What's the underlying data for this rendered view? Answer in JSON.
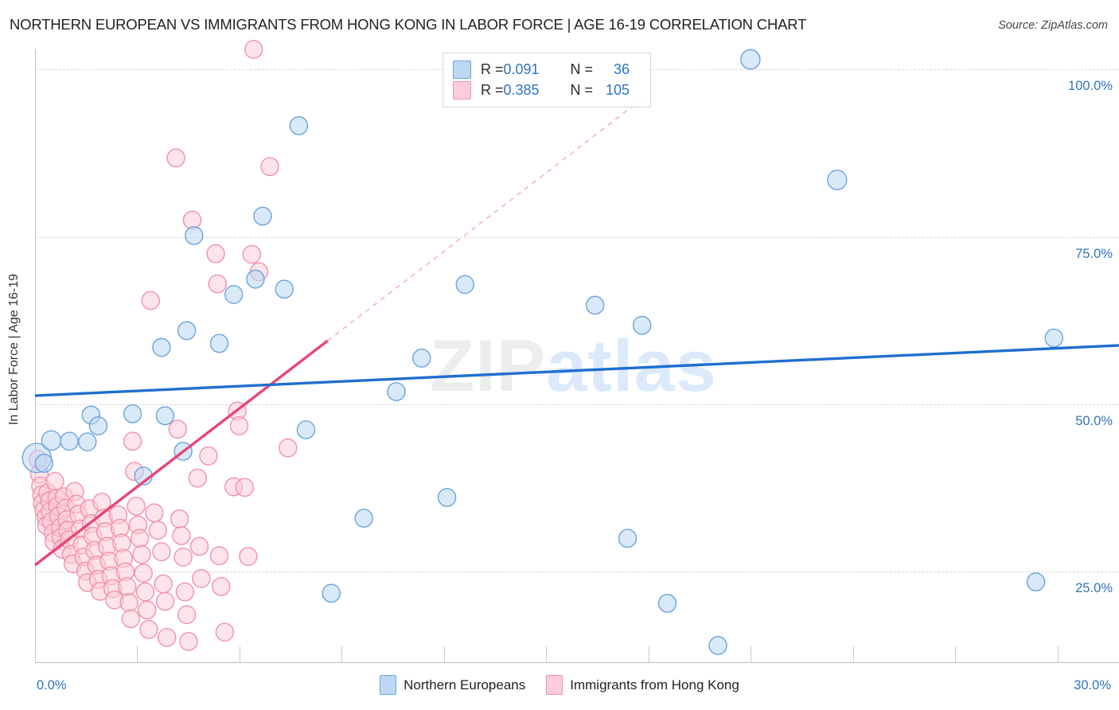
{
  "header": {
    "title": "NORTHERN EUROPEAN VS IMMIGRANTS FROM HONG KONG IN LABOR FORCE | AGE 16-19 CORRELATION CHART",
    "source": "Source: ZipAtlas.com"
  },
  "watermark": {
    "part1": "ZIP",
    "part2": "atlas"
  },
  "stat_legend": {
    "rows": [
      {
        "series": "Northern Europeans",
        "r_label": "R =",
        "r_value": "0.091",
        "n_label": "N =",
        "n_value": "36",
        "color": "#bcd7f2"
      },
      {
        "series": "Immigrants from Hong Kong",
        "r_label": "R =",
        "r_value": "0.385",
        "n_label": "N =",
        "n_value": "105",
        "color": "#fbccd9"
      }
    ]
  },
  "series_legend": {
    "items": [
      {
        "label": "Northern Europeans",
        "color": "#bcd7f2",
        "border": "#6ba3dd"
      },
      {
        "label": "Immigrants from Hong Kong",
        "color": "#fbccd9",
        "border": "#f092ac"
      }
    ]
  },
  "chart_data": {
    "type": "scatter",
    "title": "NORTHERN EUROPEAN VS IMMIGRANTS FROM HONG KONG IN LABOR FORCE | AGE 16-19 CORRELATION CHART",
    "xlabel": "",
    "ylabel": "In Labor Force | Age 16-19",
    "xlim": [
      0.0,
      30.0
    ],
    "ylim": [
      11.5,
      103.0
    ],
    "x_tick_labels": [
      "0.0%",
      "30.0%"
    ],
    "y_tick_labels": [
      "100.0%",
      "75.0%",
      "50.0%",
      "25.0%"
    ],
    "y_ticks": [
      100.0,
      75.0,
      50.0,
      25.0
    ],
    "grid": true,
    "legend_position": "bottom-center",
    "series": [
      {
        "name": "Northern Europeans",
        "color": "#bcd7f2",
        "border": "#6ba3dd",
        "r": 0.091,
        "n": 36,
        "trend": {
          "x0": 0.0,
          "y0": 51.3,
          "x1": 30.0,
          "y1": 58.8,
          "style": "solid",
          "color": "#1f6fd0"
        },
        "points": [
          {
            "x": 0.05,
            "y": 42.0,
            "r": 18
          },
          {
            "x": 0.45,
            "y": 44.6,
            "r": 12
          },
          {
            "x": 0.95,
            "y": 44.5,
            "r": 11
          },
          {
            "x": 1.45,
            "y": 44.4,
            "r": 11
          },
          {
            "x": 1.55,
            "y": 48.4,
            "r": 11
          },
          {
            "x": 1.75,
            "y": 46.8,
            "r": 11
          },
          {
            "x": 2.7,
            "y": 48.6,
            "r": 11
          },
          {
            "x": 3.0,
            "y": 39.3,
            "r": 11
          },
          {
            "x": 3.5,
            "y": 58.5,
            "r": 11
          },
          {
            "x": 3.6,
            "y": 48.3,
            "r": 11
          },
          {
            "x": 4.1,
            "y": 43.0,
            "r": 11
          },
          {
            "x": 4.2,
            "y": 61.0,
            "r": 11
          },
          {
            "x": 4.4,
            "y": 75.2,
            "r": 11
          },
          {
            "x": 5.1,
            "y": 59.1,
            "r": 11
          },
          {
            "x": 5.5,
            "y": 66.4,
            "r": 11
          },
          {
            "x": 6.1,
            "y": 68.7,
            "r": 11
          },
          {
            "x": 6.3,
            "y": 78.1,
            "r": 11
          },
          {
            "x": 6.9,
            "y": 67.2,
            "r": 11
          },
          {
            "x": 7.3,
            "y": 91.6,
            "r": 11
          },
          {
            "x": 7.5,
            "y": 46.2,
            "r": 11
          },
          {
            "x": 8.2,
            "y": 21.8,
            "r": 11
          },
          {
            "x": 9.1,
            "y": 33.0,
            "r": 11
          },
          {
            "x": 10.0,
            "y": 51.9,
            "r": 11
          },
          {
            "x": 10.7,
            "y": 56.9,
            "r": 11
          },
          {
            "x": 11.4,
            "y": 36.1,
            "r": 11
          },
          {
            "x": 11.9,
            "y": 67.9,
            "r": 11
          },
          {
            "x": 15.5,
            "y": 64.8,
            "r": 11
          },
          {
            "x": 16.4,
            "y": 30.0,
            "r": 11
          },
          {
            "x": 16.8,
            "y": 61.8,
            "r": 11
          },
          {
            "x": 17.5,
            "y": 20.3,
            "r": 11
          },
          {
            "x": 18.9,
            "y": 14.0,
            "r": 11
          },
          {
            "x": 19.8,
            "y": 101.5,
            "r": 12
          },
          {
            "x": 22.2,
            "y": 83.5,
            "r": 12
          },
          {
            "x": 27.7,
            "y": 23.5,
            "r": 11
          },
          {
            "x": 28.2,
            "y": 59.9,
            "r": 11
          },
          {
            "x": 0.25,
            "y": 41.2,
            "r": 11
          }
        ]
      },
      {
        "name": "Immigrants from Hong Kong",
        "color": "#fbccd9",
        "border": "#f092ac",
        "r": 0.385,
        "n": 105,
        "trend": {
          "x0": 0.0,
          "y0": 26.0,
          "x1": 8.1,
          "y1": 59.5,
          "style": "solid",
          "color": "#e8447a",
          "dash_x0": 8.1,
          "dash_y0": 59.5,
          "dash_x1": 16.9,
          "dash_y1": 96.0,
          "dash_color": "#f0a8bd"
        },
        "points": [
          {
            "x": 0.08,
            "y": 41.8,
            "r": 11
          },
          {
            "x": 0.12,
            "y": 39.6,
            "r": 11
          },
          {
            "x": 0.15,
            "y": 37.8,
            "r": 11
          },
          {
            "x": 0.18,
            "y": 36.5,
            "r": 11
          },
          {
            "x": 0.2,
            "y": 35.2,
            "r": 11
          },
          {
            "x": 0.25,
            "y": 34.2,
            "r": 11
          },
          {
            "x": 0.3,
            "y": 33.1,
            "r": 11
          },
          {
            "x": 0.32,
            "y": 31.9,
            "r": 11
          },
          {
            "x": 0.35,
            "y": 36.8,
            "r": 11
          },
          {
            "x": 0.4,
            "y": 35.6,
            "r": 11
          },
          {
            "x": 0.42,
            "y": 34.0,
            "r": 11
          },
          {
            "x": 0.45,
            "y": 32.5,
            "r": 11
          },
          {
            "x": 0.5,
            "y": 30.8,
            "r": 11
          },
          {
            "x": 0.52,
            "y": 29.5,
            "r": 11
          },
          {
            "x": 0.55,
            "y": 38.5,
            "r": 11
          },
          {
            "x": 0.6,
            "y": 36.0,
            "r": 11
          },
          {
            "x": 0.62,
            "y": 34.8,
            "r": 11
          },
          {
            "x": 0.65,
            "y": 33.3,
            "r": 11
          },
          {
            "x": 0.7,
            "y": 31.6,
            "r": 11
          },
          {
            "x": 0.72,
            "y": 30.1,
            "r": 11
          },
          {
            "x": 0.75,
            "y": 28.4,
            "r": 11
          },
          {
            "x": 0.8,
            "y": 36.2,
            "r": 11
          },
          {
            "x": 0.85,
            "y": 34.5,
            "r": 11
          },
          {
            "x": 0.88,
            "y": 32.8,
            "r": 11
          },
          {
            "x": 0.9,
            "y": 31.2,
            "r": 11
          },
          {
            "x": 0.95,
            "y": 29.8,
            "r": 11
          },
          {
            "x": 1.0,
            "y": 27.6,
            "r": 11
          },
          {
            "x": 1.05,
            "y": 26.2,
            "r": 11
          },
          {
            "x": 1.1,
            "y": 37.0,
            "r": 11
          },
          {
            "x": 1.15,
            "y": 35.1,
            "r": 11
          },
          {
            "x": 1.2,
            "y": 33.6,
            "r": 11
          },
          {
            "x": 1.25,
            "y": 31.4,
            "r": 11
          },
          {
            "x": 1.3,
            "y": 29.0,
            "r": 11
          },
          {
            "x": 1.35,
            "y": 27.2,
            "r": 11
          },
          {
            "x": 1.4,
            "y": 25.1,
            "r": 11
          },
          {
            "x": 1.45,
            "y": 23.4,
            "r": 11
          },
          {
            "x": 1.5,
            "y": 34.4,
            "r": 11
          },
          {
            "x": 1.55,
            "y": 32.2,
            "r": 11
          },
          {
            "x": 1.6,
            "y": 30.3,
            "r": 11
          },
          {
            "x": 1.65,
            "y": 28.2,
            "r": 11
          },
          {
            "x": 1.7,
            "y": 26.0,
            "r": 11
          },
          {
            "x": 1.75,
            "y": 23.9,
            "r": 11
          },
          {
            "x": 1.8,
            "y": 22.1,
            "r": 11
          },
          {
            "x": 1.85,
            "y": 35.4,
            "r": 11
          },
          {
            "x": 1.9,
            "y": 33.0,
            "r": 11
          },
          {
            "x": 1.95,
            "y": 31.0,
            "r": 11
          },
          {
            "x": 2.0,
            "y": 28.8,
            "r": 11
          },
          {
            "x": 2.05,
            "y": 26.6,
            "r": 11
          },
          {
            "x": 2.1,
            "y": 24.4,
            "r": 11
          },
          {
            "x": 2.15,
            "y": 22.5,
            "r": 11
          },
          {
            "x": 2.2,
            "y": 20.8,
            "r": 11
          },
          {
            "x": 2.3,
            "y": 33.5,
            "r": 11
          },
          {
            "x": 2.35,
            "y": 31.5,
            "r": 11
          },
          {
            "x": 2.4,
            "y": 29.3,
            "r": 11
          },
          {
            "x": 2.45,
            "y": 27.0,
            "r": 11
          },
          {
            "x": 2.5,
            "y": 25.0,
            "r": 11
          },
          {
            "x": 2.55,
            "y": 22.8,
            "r": 11
          },
          {
            "x": 2.6,
            "y": 20.4,
            "r": 11
          },
          {
            "x": 2.65,
            "y": 18.0,
            "r": 11
          },
          {
            "x": 2.7,
            "y": 44.5,
            "r": 11
          },
          {
            "x": 2.75,
            "y": 40.0,
            "r": 11
          },
          {
            "x": 2.8,
            "y": 34.8,
            "r": 11
          },
          {
            "x": 2.85,
            "y": 32.0,
            "r": 11
          },
          {
            "x": 2.9,
            "y": 30.0,
            "r": 11
          },
          {
            "x": 2.95,
            "y": 27.6,
            "r": 11
          },
          {
            "x": 3.0,
            "y": 24.8,
            "r": 11
          },
          {
            "x": 3.05,
            "y": 22.0,
            "r": 11
          },
          {
            "x": 3.1,
            "y": 19.3,
            "r": 11
          },
          {
            "x": 3.15,
            "y": 16.4,
            "r": 11
          },
          {
            "x": 3.2,
            "y": 65.5,
            "r": 11
          },
          {
            "x": 3.3,
            "y": 33.8,
            "r": 11
          },
          {
            "x": 3.4,
            "y": 31.2,
            "r": 11
          },
          {
            "x": 3.5,
            "y": 28.0,
            "r": 11
          },
          {
            "x": 3.55,
            "y": 23.2,
            "r": 11
          },
          {
            "x": 3.6,
            "y": 20.6,
            "r": 11
          },
          {
            "x": 3.65,
            "y": 15.2,
            "r": 11
          },
          {
            "x": 3.9,
            "y": 86.8,
            "r": 11
          },
          {
            "x": 3.95,
            "y": 46.3,
            "r": 11
          },
          {
            "x": 4.0,
            "y": 32.9,
            "r": 11
          },
          {
            "x": 4.05,
            "y": 30.4,
            "r": 11
          },
          {
            "x": 4.1,
            "y": 27.2,
            "r": 11
          },
          {
            "x": 4.15,
            "y": 22.0,
            "r": 11
          },
          {
            "x": 4.2,
            "y": 18.6,
            "r": 11
          },
          {
            "x": 4.25,
            "y": 14.6,
            "r": 11
          },
          {
            "x": 4.35,
            "y": 77.5,
            "r": 11
          },
          {
            "x": 4.5,
            "y": 39.0,
            "r": 11
          },
          {
            "x": 4.55,
            "y": 28.8,
            "r": 11
          },
          {
            "x": 4.6,
            "y": 24.0,
            "r": 11
          },
          {
            "x": 4.8,
            "y": 42.3,
            "r": 11
          },
          {
            "x": 5.0,
            "y": 72.5,
            "r": 11
          },
          {
            "x": 5.05,
            "y": 68.0,
            "r": 11
          },
          {
            "x": 5.1,
            "y": 27.4,
            "r": 11
          },
          {
            "x": 5.15,
            "y": 22.8,
            "r": 11
          },
          {
            "x": 5.25,
            "y": 16.0,
            "r": 11
          },
          {
            "x": 5.5,
            "y": 37.7,
            "r": 11
          },
          {
            "x": 5.6,
            "y": 49.0,
            "r": 11
          },
          {
            "x": 5.65,
            "y": 46.8,
            "r": 11
          },
          {
            "x": 5.8,
            "y": 37.6,
            "r": 11
          },
          {
            "x": 5.9,
            "y": 27.3,
            "r": 11
          },
          {
            "x": 6.0,
            "y": 72.4,
            "r": 11
          },
          {
            "x": 6.05,
            "y": 103.0,
            "r": 11
          },
          {
            "x": 6.2,
            "y": 69.8,
            "r": 11
          },
          {
            "x": 6.5,
            "y": 85.5,
            "r": 11
          },
          {
            "x": 7.0,
            "y": 43.5,
            "r": 11
          }
        ]
      }
    ]
  }
}
